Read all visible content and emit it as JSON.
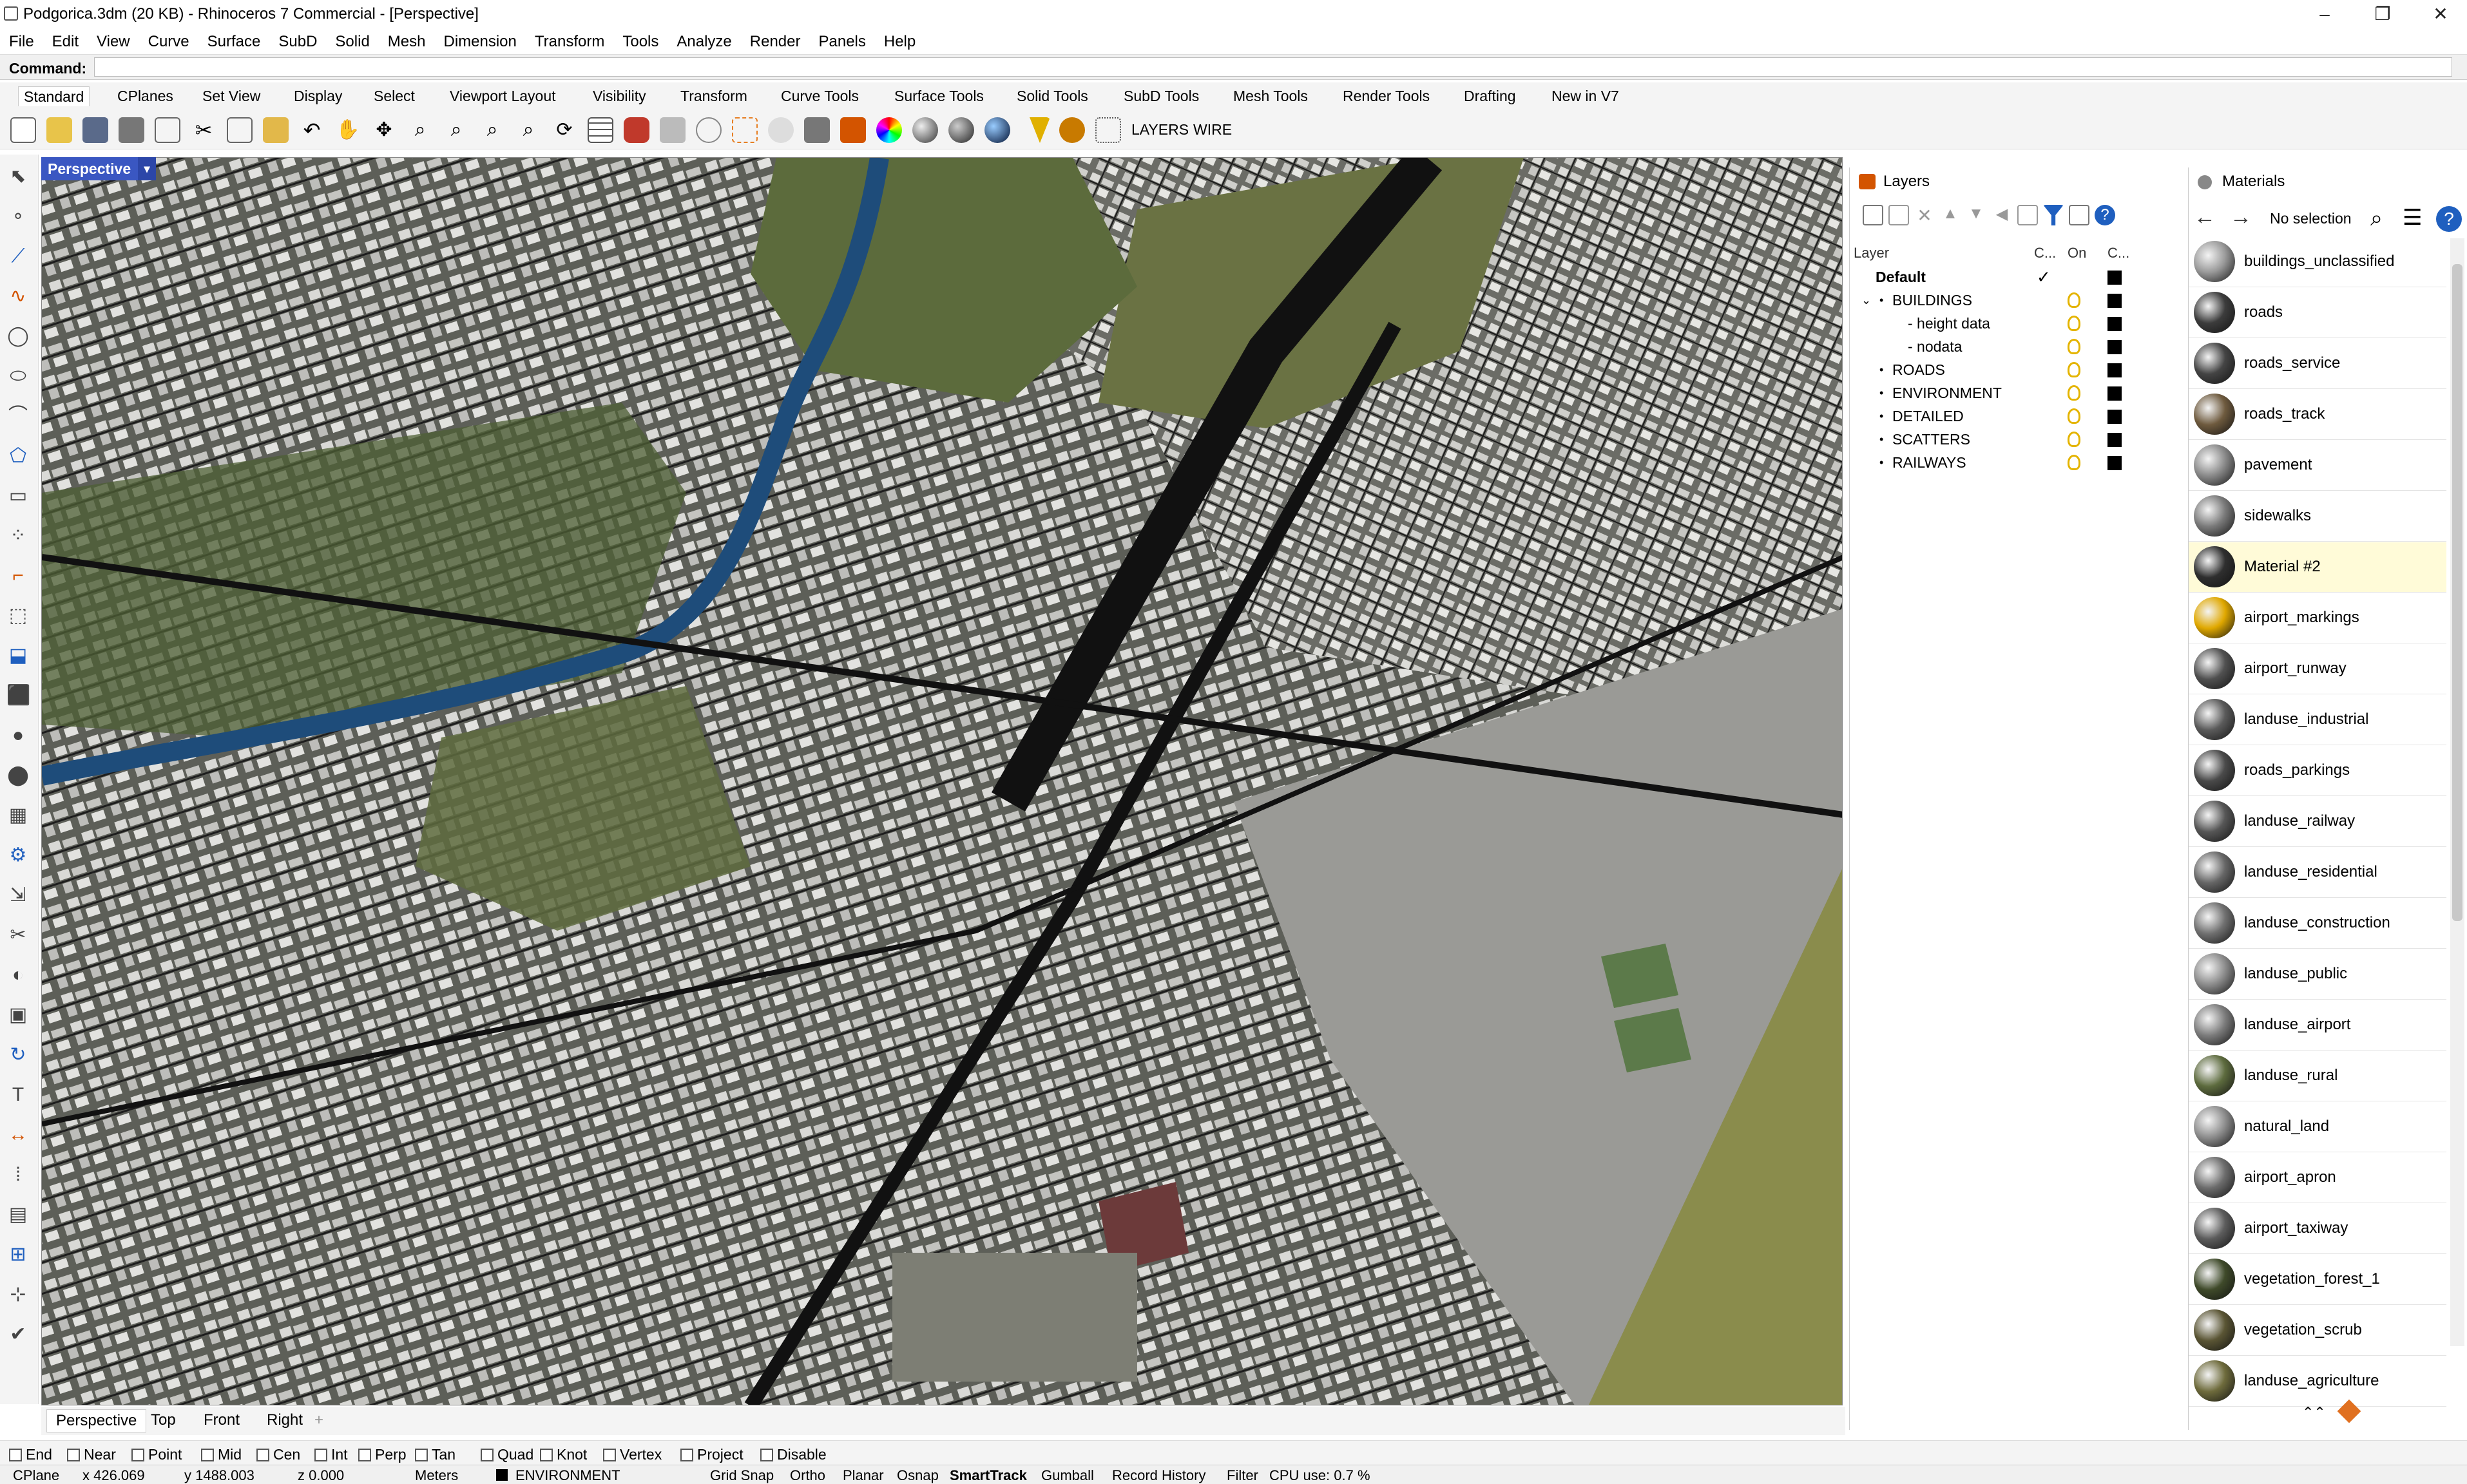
{
  "window": {
    "title": "Podgorica.3dm (20 KB) - Rhinoceros 7 Commercial - [Perspective]"
  },
  "menu": [
    "File",
    "Edit",
    "View",
    "Curve",
    "Surface",
    "SubD",
    "Solid",
    "Mesh",
    "Dimension",
    "Transform",
    "Tools",
    "Analyze",
    "Render",
    "Panels",
    "Help"
  ],
  "command": {
    "label": "Command:",
    "value": ""
  },
  "toolbar_tabs": [
    "Standard",
    "CPlanes",
    "Set View",
    "Display",
    "Select",
    "Viewport Layout",
    "Visibility",
    "Transform",
    "Curve Tools",
    "Surface Tools",
    "Solid Tools",
    "SubD Tools",
    "Mesh Tools",
    "Render Tools",
    "Drafting",
    "New in V7"
  ],
  "toolbar": {
    "layers_label": "LAYERS",
    "wire_label": "WIRE"
  },
  "viewport": {
    "label": "Perspective"
  },
  "layers_panel": {
    "title": "Layers",
    "columns": {
      "layer": "Layer",
      "current": "C...",
      "on": "On",
      "color": "C..."
    },
    "rows": [
      {
        "name": "Default",
        "current": "✓"
      },
      {
        "name": "BUILDINGS",
        "current": ""
      },
      {
        "name": "- height data",
        "current": ""
      },
      {
        "name": "- nodata",
        "current": ""
      },
      {
        "name": "ROADS",
        "current": ""
      },
      {
        "name": "ENVIRONMENT",
        "current": ""
      },
      {
        "name": "DETAILED",
        "current": ""
      },
      {
        "name": "SCATTERS",
        "current": ""
      },
      {
        "name": "RAILWAYS",
        "current": ""
      }
    ]
  },
  "materials_panel": {
    "title": "Materials",
    "selection": "No selection",
    "items": [
      {
        "name": "buildings_unclassified",
        "color": "#9a9a9a"
      },
      {
        "name": "roads",
        "color": "#3c3c3c"
      },
      {
        "name": "roads_service",
        "color": "#444444"
      },
      {
        "name": "roads_track",
        "color": "#6e5a3e"
      },
      {
        "name": "pavement",
        "color": "#8a8a8a"
      },
      {
        "name": "sidewalks",
        "color": "#7a7a7a"
      },
      {
        "name": "Material #2",
        "color": "#2f2f2f"
      },
      {
        "name": "airport_markings",
        "color": "#e0a800"
      },
      {
        "name": "airport_runway",
        "color": "#505050"
      },
      {
        "name": "landuse_industrial",
        "color": "#5a5a5a"
      },
      {
        "name": "roads_parkings",
        "color": "#4a4a4a"
      },
      {
        "name": "landuse_railway",
        "color": "#565656"
      },
      {
        "name": "landuse_residential",
        "color": "#666666"
      },
      {
        "name": "landuse_construction",
        "color": "#707070"
      },
      {
        "name": "landuse_public",
        "color": "#8c8c8c"
      },
      {
        "name": "landuse_airport",
        "color": "#7c7c7c"
      },
      {
        "name": "landuse_rural",
        "color": "#5d6b3e"
      },
      {
        "name": "natural_land",
        "color": "#8e8e8e"
      },
      {
        "name": "airport_apron",
        "color": "#6c6c6c"
      },
      {
        "name": "airport_taxiway",
        "color": "#5c5c5c"
      },
      {
        "name": "vegetation_forest_1",
        "color": "#3f4a2a"
      },
      {
        "name": "vegetation_scrub",
        "color": "#5a5534"
      },
      {
        "name": "landuse_agriculture",
        "color": "#6e6b3c"
      }
    ]
  },
  "viewport_tabs": [
    "Perspective",
    "Top",
    "Front",
    "Right"
  ],
  "osnaps": [
    "End",
    "Near",
    "Point",
    "Mid",
    "Cen",
    "Int",
    "Perp",
    "Tan",
    "Quad",
    "Knot",
    "Vertex",
    "Project",
    "Disable"
  ],
  "status": {
    "cplane": "CPlane",
    "x": "x 426.069",
    "y": "y 1488.003",
    "z": "z 0.000",
    "units": "Meters",
    "layer": "ENVIRONMENT",
    "grid_snap": "Grid Snap",
    "ortho": "Ortho",
    "planar": "Planar",
    "osnap": "Osnap",
    "smarttrack": "SmartTrack",
    "gumball": "Gumball",
    "record_history": "Record History",
    "filter": "Filter",
    "cpu": "CPU use: 0.7 %"
  }
}
